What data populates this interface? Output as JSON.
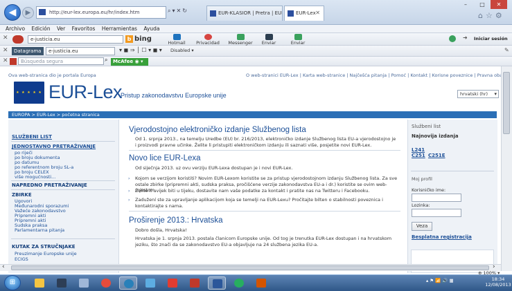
{
  "browser": {
    "url": "http://eur-lex.europa.eu/hr/index.htm",
    "tabs": [
      {
        "label": "EUR-KLASIOR | Pretra | EUR-Lex"
      },
      {
        "label": "EUR-Lex"
      }
    ],
    "window_controls": {
      "minimize": "–",
      "maximize": "□",
      "close": "✕"
    }
  },
  "menu": {
    "items": [
      "Archivo",
      "Edición",
      "Ver",
      "Favoritos",
      "Herramientas",
      "Ayuda"
    ]
  },
  "toolbar1": {
    "search_value": "e-justicia.eu",
    "bing": "bing",
    "buttons": [
      "Hotmail",
      "Privacidad",
      "Messenger",
      "Enviar página",
      "Enviar página"
    ],
    "right_label": "Iniciar sesión"
  },
  "toolbar2": {
    "logo": "Datagrama",
    "search_value": "e-justicia.eu",
    "disabled_label": "Disabled"
  },
  "toolbar3": {
    "search_placeholder": "Búsqueda segura",
    "mcafee": "McAfee"
  },
  "site": {
    "top_left": "Ova web-stranica dio je portala Europa",
    "top_links": "O web-stranici EUR-Lex | Karta web-stranice | Najčešća pitanja | Pomoć | Kontakt | Korisne poveznice | Pravna obavijest",
    "logo": "EUR-Lex",
    "tagline": "Pristup zakonodavstvu Europske unije",
    "language": "hrvatski (hr)",
    "breadcrumb": "EUROPA > EUR-Lex > početna stranica"
  },
  "leftnav": {
    "sections": [
      {
        "heading": "SLUŽBENI LIST",
        "items": []
      },
      {
        "heading": "JEDNOSTAVNO PRETRAŽIVANJE",
        "items": [
          "po riječi",
          "po broju dokumenta",
          "po datumu",
          "po referentnom broju SL-a",
          "po broju CELEX",
          "više mogućnosti..."
        ]
      },
      {
        "heading": "NAPREDNO PRETRAŽIVANJE",
        "items": []
      },
      {
        "heading": "ZBIRKE",
        "items": [
          "Ugovori",
          "Međunarodni sporazumi",
          "Važeće zakonodavstvo",
          "Pripremni akti",
          "Pripremni akti",
          "Sudska praksa",
          "Parlamentarna pitanja"
        ]
      },
      {
        "heading": "KUTAK ZA STRUČNJAKE",
        "items": [
          "Preuzimanje Europske unije",
          "ECIGS"
        ]
      }
    ]
  },
  "main": {
    "h1": "Vjerodostojno elektroničko izdanje Službenog lista",
    "p1": "Od 1. srpnja 2013., na temelju Uredbe (EU) br. 216/2013, elektroničko izdanje Službenog lista EU-a vjerodostojno je i proizvodi pravne učinke. Želite li pristupiti elektroničkom izdanju ili saznati više, posjetite novi EUR-Lex.",
    "h2": "Novo lice EUR-Lexa",
    "p2": "Od siječnja 2013. uz ovu verziju EUR-Lexa dostupan je i novi EUR-Lex.",
    "bullets": [
      "Kojom se verzijom koristiti? Novim EUR-Lexom koristite se za pristup vjerodostojnom izdanju Službenog lista. Za sve ostale zbirke (pripremni akti, sudska praksa, pročišćene verzije zakonodavstva EU-a i dr.) koristite se ovim web-mjestom.",
      "Želite li uvijek biti u tijeku, dostavite nam vaše podatke za kontakt i pratite nas na Twitteru i Facebooku.",
      "Zadužení ste za upravljanje aplikacijom koja se temelji na EUR-Lexu? Pročitajte bilten o stabilnosti poveznica i kontaktirajte s nama."
    ],
    "h3": "Proširenje 2013.: Hrvatska",
    "p3": "Dobro došla, Hrvatska!",
    "p4": "Hrvatska je 1. srpnja 2013. postala članicom Europske unije. Od tog je trenutka EUR-Lex dostupan i na hrvatskom jeziku, što znači da se zakonodavstvo EU-a objavljuje na 24 službena jezika EU-a."
  },
  "right": {
    "sl_heading": "Službeni list",
    "sl_latest": "Najnovija izdanja",
    "issues": [
      "L241",
      "C251",
      "C251E"
    ],
    "profile_heading": "Moj profil",
    "user_label": "Korisničko ime:",
    "pass_label": "Lozinka:",
    "veza": "Veza",
    "register": "Besplatna registracija"
  },
  "status": {
    "zoom": "100%"
  },
  "taskbar": {
    "time": "18:34",
    "date": "12/08/2013"
  }
}
